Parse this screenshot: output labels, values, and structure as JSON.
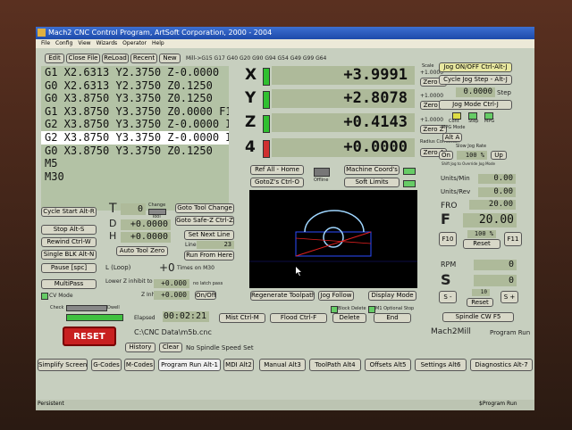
{
  "window": {
    "title": "Mach2 CNC Control Program, ArtSoft Corporation, 2000 - 2004"
  },
  "menu": [
    "File",
    "Config",
    "View",
    "Wizards",
    "Operator",
    "Help"
  ],
  "toolbar": {
    "edit": "Edit",
    "close": "Close File",
    "reload": "ReLoad",
    "recent": "Recent",
    "new": "New",
    "modal": "Mill->G15  G17 G40 G20 G90 G94 G54 G49 G99 G64"
  },
  "gcode_lines": [
    "G1 X2.6313 Y2.3750 Z-0.0000",
    "G0 X2.6313 Y2.3750 Z0.1250",
    "G0 X3.8750 Y3.3750 Z0.1250",
    "G1 X3.8750 Y3.3750 Z0.0000 F10",
    "G2 X3.8750 Y3.3750 Z-0.0000 I0.",
    "G2 X3.8750 Y3.3750 Z-0.0000 I0.",
    "G0 X3.8750 Y3.3750 Z0.1250",
    "M5",
    "M30"
  ],
  "axes": [
    {
      "label": "X",
      "value": "+3.9991"
    },
    {
      "label": "Y",
      "value": "+2.8078"
    },
    {
      "label": "Z",
      "value": "+0.4143"
    },
    {
      "label": "4",
      "value": "+0.0000"
    }
  ],
  "scale": {
    "label": "Scale",
    "value": "+1.0000",
    "zero_x": "Zero X",
    "zero_y": "Zero Y",
    "zero_z": "Zero Z",
    "zero_4": "Zero 4",
    "radius": "Radius Correction"
  },
  "right": {
    "jog_toggle": "Jog ON/OFF Ctrl-Alt-J",
    "jog_step": "Cycle Jog Step - Alt-J",
    "step_value": "0.0000",
    "step_label": "Step",
    "jog_mode": "Jog Mode Ctrl-J",
    "cont": "Cont",
    "step": "Step",
    "mpg": "MPG",
    "mpg_mode": "MPG Mode",
    "alt_a": "Alt A",
    "slow_jog": "Slow Jog Rate",
    "on": "On",
    "jog_pct": "100 %",
    "up": "Up",
    "shift_jog": "Shift Jog to Override Jog Mode"
  },
  "feed": {
    "units_min_label": "Units/Min",
    "units_min": "0.00",
    "units_rev_label": "Units/Rev",
    "units_rev": "0.00",
    "fro_label": "FRO",
    "fro": "20.00",
    "f_label": "F",
    "f_value": "20.00",
    "f10": "F10",
    "f11": "F11",
    "fro_pct": "100 %",
    "reset": "Reset"
  },
  "spindle": {
    "rpm_label": "RPM",
    "rpm": "0",
    "s_label": "S",
    "s_value": "0",
    "minus": "S -",
    "plus": "S +",
    "pct": "10",
    "reset": "Reset",
    "cw": "Spindle CW F5"
  },
  "mid": {
    "ref_all": "Ref All - Home",
    "goto_zero": "GotoZ's Ctrl-O",
    "offline": "Offline",
    "machine_coords": "Machine Coord's",
    "soft_limits": "Soft Limits",
    "regen": "Regenerate Toolpath",
    "jog_follow": "Jog Follow",
    "display_mode": "Display Mode"
  },
  "tool": {
    "cycle_start": "Cycle Start Alt-R",
    "stop": "Stop Alt-S",
    "rewind": "Rewind Ctrl-W",
    "single_blk": "Single BLK Alt-N",
    "pause": "Pause [spc]",
    "multipass": "MultiPass",
    "t_label": "T",
    "t_value": "0",
    "change": "Change",
    "tool": "Tool",
    "d_label": "D",
    "d_value": "+0.0000",
    "h_label": "H",
    "h_value": "+0.0000",
    "goto_change": "Goto Tool Change",
    "goto_safe": "Goto Safe-Z Ctrl-Z",
    "set_next": "Set Next Line",
    "line_label": "Line",
    "line_value": "23",
    "run_from": "Run From Here",
    "auto_zero": "Auto Tool Zero",
    "l_label": "L (Loop)",
    "l_value": "+0",
    "times_m30": "Times on M30",
    "cv_mode": "CV Mode",
    "lower_z": "Lower Z inhibit to",
    "lower_val": "+0.000",
    "no_latch": "no latch pass",
    "z_inhibit": "Z Inhibit",
    "z_val": "+0.000",
    "on_off": "On/Off"
  },
  "bottom": {
    "check": "Check",
    "dwell": "Dwell",
    "reset": "RESET",
    "elapsed_label": "Elapsed",
    "elapsed": "00:02:21",
    "mist": "Mist Ctrl-M",
    "flood": "Flood Ctrl-F",
    "delete": "Delete",
    "end": "End",
    "file": "C:\\CNC Data\\m5b.cnc",
    "history": "History",
    "clear": "Clear",
    "message": "No Spindle Speed Set",
    "mach": "Mach2Mill",
    "run_status": "Program Run",
    "block_delete": "Block Delete",
    "m1": "M1 Optional Stop"
  },
  "tabs": [
    "Simplify Screen",
    "G-Codes",
    "M-Codes",
    "Program Run Alt-1",
    "MDI Alt2",
    "Manual Alt3",
    "ToolPath Alt4",
    "Offsets Alt5",
    "Settings Alt6",
    "Diagnostics Alt-7"
  ],
  "statusbar": {
    "left": "Persistent",
    "right": "$Program Run"
  }
}
